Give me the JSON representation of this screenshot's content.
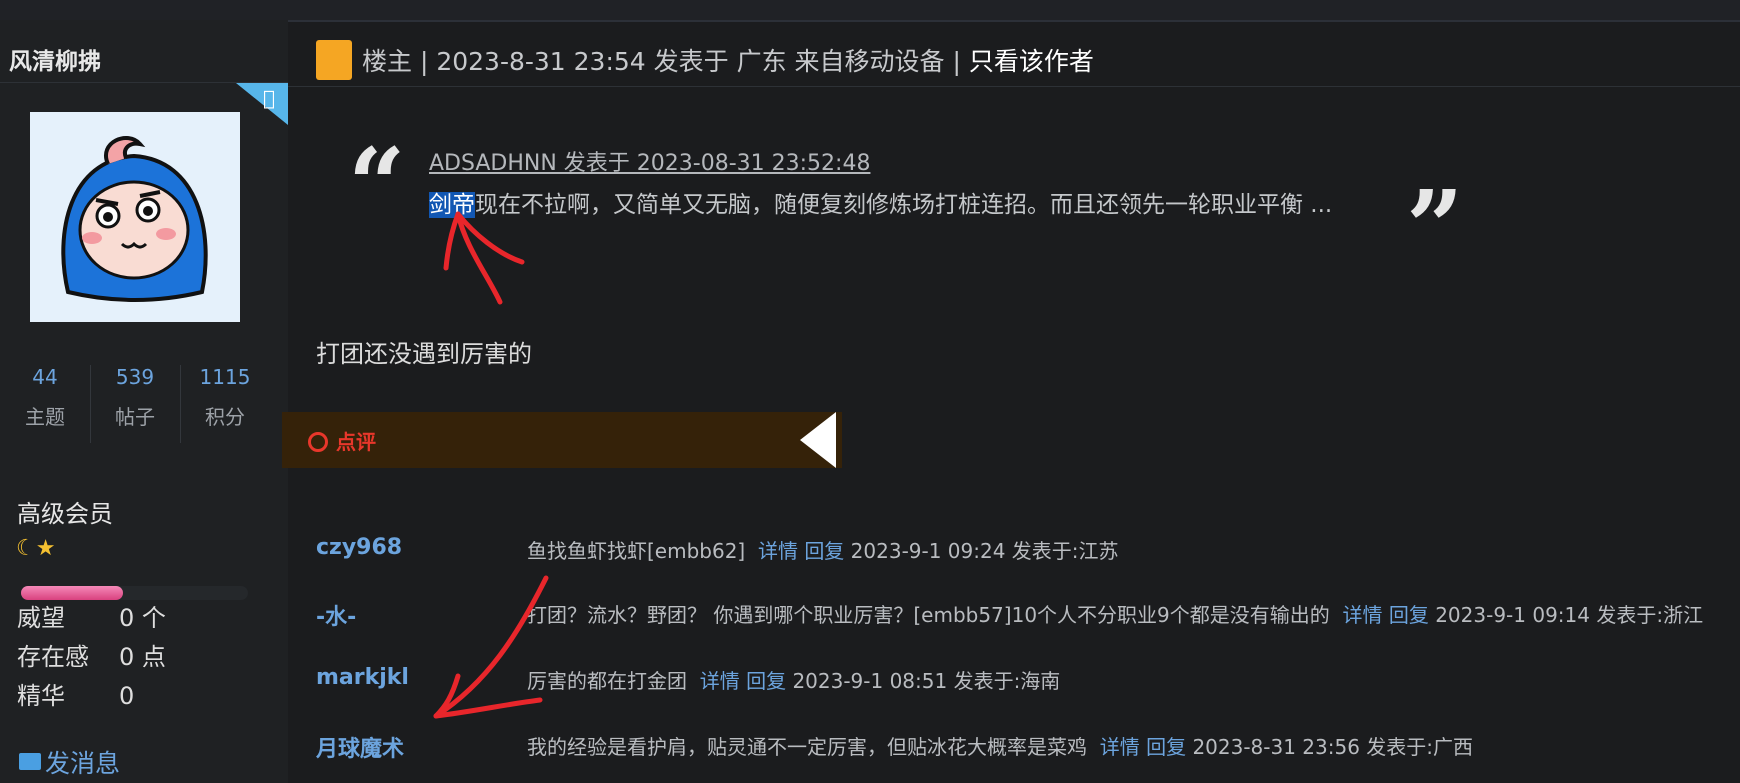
{
  "sidebar": {
    "username": "风清柳拂",
    "stats": [
      {
        "value": "44",
        "label": "主题"
      },
      {
        "value": "539",
        "label": "帖子"
      },
      {
        "value": "1115",
        "label": "积分"
      }
    ],
    "rank": "高级会员",
    "rank_progress": 0.45,
    "info": [
      {
        "label": "威望",
        "value": "0 个"
      },
      {
        "label": "存在感",
        "value": "0 点"
      },
      {
        "label": "精华",
        "value": "0"
      }
    ],
    "send_message": "发消息"
  },
  "post": {
    "header_prefix": "楼主 |  2023-8-31 23:54 发表于 广东 来自移动设备  |",
    "only_author": "只看该作者",
    "quote": {
      "meta": "ADSADHNN 发表于 2023-08-31 23:52:48",
      "highlight": "剑帝",
      "rest": "现在不拉啊，又简单又无脑，随便复刻修炼场打桩连招。而且还领先一轮职业平衡 ..."
    },
    "text": "打团还没遇到厉害的",
    "comment_section": "点评"
  },
  "comments": [
    {
      "user": "czy968",
      "text": "鱼找鱼虾找虾[embb62]",
      "detail": "详情",
      "reply": "回复",
      "time": "2023-9-1 09:24 发表于:江苏"
    },
    {
      "user": "-水-",
      "text": "打团？流水？野团？ 你遇到哪个职业厉害？[embb57]10个人不分职业9个都是没有输出的",
      "detail": "详情",
      "reply": "回复",
      "time": "2023-9-1 09:14 发表于:浙江"
    },
    {
      "user": "markjkl",
      "text": "厉害的都在打金团",
      "detail": "详情",
      "reply": "回复",
      "time": "2023-9-1 08:51 发表于:海南"
    },
    {
      "user": "月球魔术",
      "text": "我的经验是看护肩，贴灵通不一定厉害，但贴冰花大概率是菜鸡",
      "detail": "详情",
      "reply": "回复",
      "time": "2023-8-31 23:56 发表于:广西"
    }
  ],
  "colors": {
    "link": "#6ca4de",
    "highlight": "#1257b3",
    "annotation": "#e8262b"
  }
}
